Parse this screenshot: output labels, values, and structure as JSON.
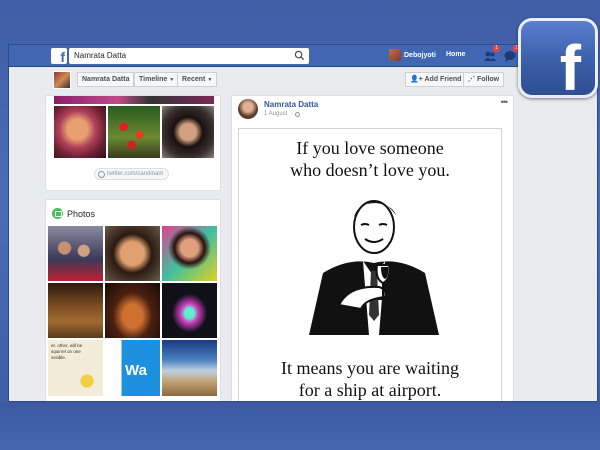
{
  "topbar": {
    "search_value": "Namrata Datta",
    "user_name": "Debojyoti",
    "home_label": "Home",
    "friend_requests_badge": "1",
    "messages_badge": "1",
    "brand_color": "#4267b2"
  },
  "profile_bar": {
    "name": "Namrata Datta",
    "timeline_label": "Timeline",
    "recent_label": "Recent",
    "add_friend_label": "Add Friend",
    "follow_label": "Follow"
  },
  "intro": {
    "twitter_link": "twitter.com/candinam"
  },
  "photos": {
    "title": "Photos",
    "thumb_texts": [
      "er. other, will be",
      "squirrel on one",
      "sssible.",
      "Wa"
    ]
  },
  "post": {
    "author": "Namrata Datta",
    "date": "1 August",
    "privacy_icon": "globe-icon",
    "meme_top_line1": "If you love someone",
    "meme_top_line2": "who doesn’t love you.",
    "meme_bottom_line1": "It means you are waiting",
    "meme_bottom_line2": "for a ship at airport."
  },
  "overlay_logo": "f",
  "small_logo": "f"
}
